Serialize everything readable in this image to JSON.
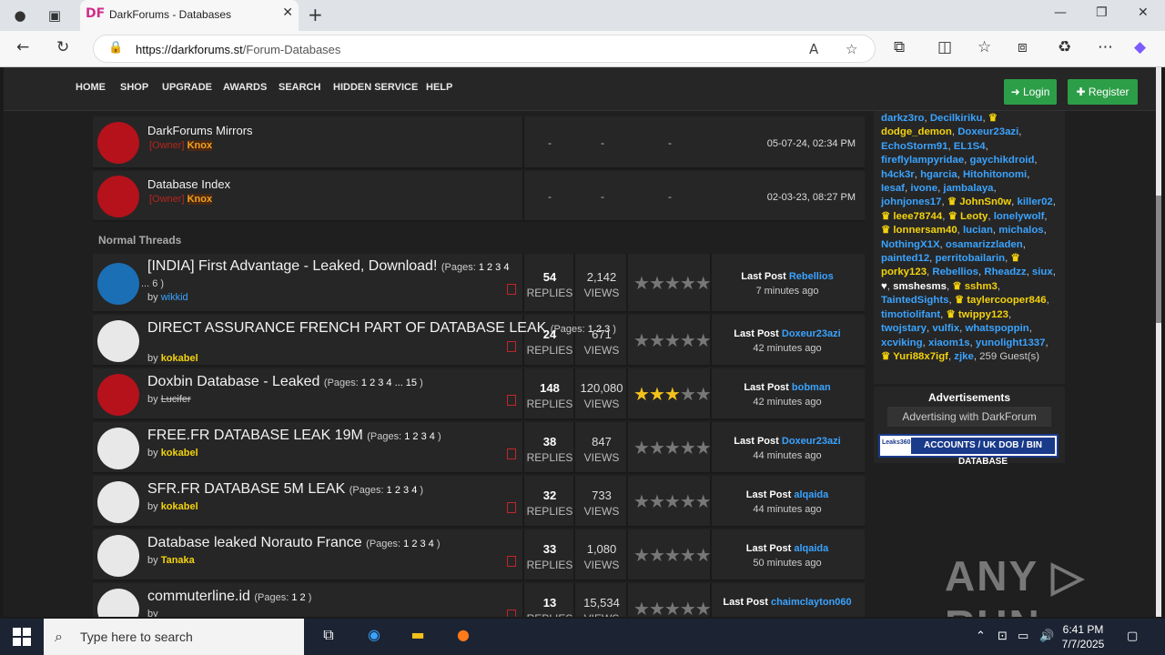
{
  "browser": {
    "tab_title": "DarkForums - Databases",
    "tab_favicon": "DF",
    "url_host": "https://darkforums.st",
    "url_path": "/Forum-Databases"
  },
  "site": {
    "menu": [
      "HOME",
      "SHOP",
      "UPGRADE",
      "AWARDS",
      "SEARCH",
      "HIDDEN SERVICE",
      "HELP"
    ],
    "login": "Login",
    "register": "Register"
  },
  "sticky": [
    {
      "title": "DarkForums Mirrors",
      "role": "[Owner]",
      "author": "Knox",
      "dash": "-",
      "date": "05-07-24, 02:34 PM"
    },
    {
      "title": "Database Index",
      "role": "[Owner]",
      "author": "Knox",
      "dash": "-",
      "date": "02-03-23, 08:27 PM"
    }
  ],
  "section": "Normal Threads",
  "threads": [
    {
      "title": "[INDIA] First Advantage - Leaked, Download!",
      "pages_label": "(Pages:",
      "pages": "1 2 3 4",
      "pages2": "... 6 )",
      "by": "by",
      "author": "wikkid",
      "replies": "54",
      "replies_label": "REPLIES",
      "views": "2,142",
      "views_label": "VIEWS",
      "rating": 0,
      "lp_label": "Last Post",
      "lp_user": "Rebellios",
      "lp_ago": "7 minutes ago"
    },
    {
      "title": "DIRECT ASSURANCE FRENCH PART OF DATABASE LEAK",
      "pages_label": "(Pages:",
      "pages": "1 2 3",
      "pages2": ")",
      "by": "by",
      "author": "kokabel",
      "replies": "24",
      "replies_label": "REPLIES",
      "views": "671",
      "views_label": "VIEWS",
      "rating": 0,
      "lp_label": "Last Post",
      "lp_user": "Doxeur23azi",
      "lp_ago": "42 minutes ago"
    },
    {
      "title": "Doxbin Database - Leaked",
      "pages_label": "(Pages:",
      "pages": "1 2 3 4 ... 15",
      "pages2": ")",
      "by": "by",
      "author": "Lucifer",
      "replies": "148",
      "replies_label": "REPLIES",
      "views": "120,080",
      "views_label": "VIEWS",
      "rating": 3,
      "lp_label": "Last Post",
      "lp_user": "bobman",
      "lp_ago": "42 minutes ago"
    },
    {
      "title": "FREE.FR DATABASE LEAK 19M",
      "pages_label": "(Pages:",
      "pages": "1 2 3 4",
      "pages2": ")",
      "by": "by",
      "author": "kokabel",
      "replies": "38",
      "replies_label": "REPLIES",
      "views": "847",
      "views_label": "VIEWS",
      "rating": 0,
      "lp_label": "Last Post",
      "lp_user": "Doxeur23azi",
      "lp_ago": "44 minutes ago"
    },
    {
      "title": "SFR.FR DATABASE 5M LEAK",
      "pages_label": "(Pages:",
      "pages": "1 2 3 4",
      "pages2": ")",
      "by": "by",
      "author": "kokabel",
      "replies": "32",
      "replies_label": "REPLIES",
      "views": "733",
      "views_label": "VIEWS",
      "rating": 0,
      "lp_label": "Last Post",
      "lp_user": "alqaida",
      "lp_ago": "44 minutes ago"
    },
    {
      "title": "Database leaked Norauto France",
      "pages_label": "(Pages:",
      "pages": "1 2 3 4",
      "pages2": ")",
      "by": "by",
      "author": "Tanaka",
      "replies": "33",
      "replies_label": "REPLIES",
      "views": "1,080",
      "views_label": "VIEWS",
      "rating": 0,
      "lp_label": "Last Post",
      "lp_user": "alqaida",
      "lp_ago": "50 minutes ago"
    },
    {
      "title": "commuterline.id",
      "pages_label": "(Pages:",
      "pages": "1 2",
      "pages2": ")",
      "by": "by",
      "author": "",
      "replies": "13",
      "replies_label": "REPLIES",
      "views": "15,534",
      "views_label": "VIEWS",
      "rating": 0,
      "lp_label": "Last Post",
      "lp_user": "chaimclayton060",
      "lp_ago": ""
    }
  ],
  "online_users": "darkz3ro, Decilkiriku, ♛ dodge_demon, Doxeur23azi, EchoStorm91, EL1S4, fireflylampyridae, gaychikdroid, h4ck3r, hgarcia, Hitohitonomi, Iesaf, ivone, jambalaya, johnjones17, ♛ JohnSn0w, killer02, ♛ leee78744, ♛ Leoty, lonelywolf, ♛ lonnersam40, lucian, michalos, NothingX1X, osamarizzladen, painted12, perritobailarin, ♛ porky123, Rebellios, Rheadzz, siux, ♥, smshesms, ♛ sshm3, TaintedSights, ♛ taylercooper846, timotiolifant, ♛ twippy123, twojstary, vulfix, whatspoppin, xcviking, xiaom1s, yunolight1337, ♛ Yuri88x7igf, zjke, 259 Guest(s)",
  "ads": {
    "title": "Advertisements",
    "button": "Advertising with DarkForum",
    "banner": "ACCOUNTS / UK DOB / BIN DATABASE",
    "banner_logo": "Leaks360"
  },
  "watermark": "ANY ▷ RUN",
  "taskbar": {
    "search_placeholder": "Type here to search",
    "time": "6:41 PM",
    "date": "7/7/2025"
  }
}
